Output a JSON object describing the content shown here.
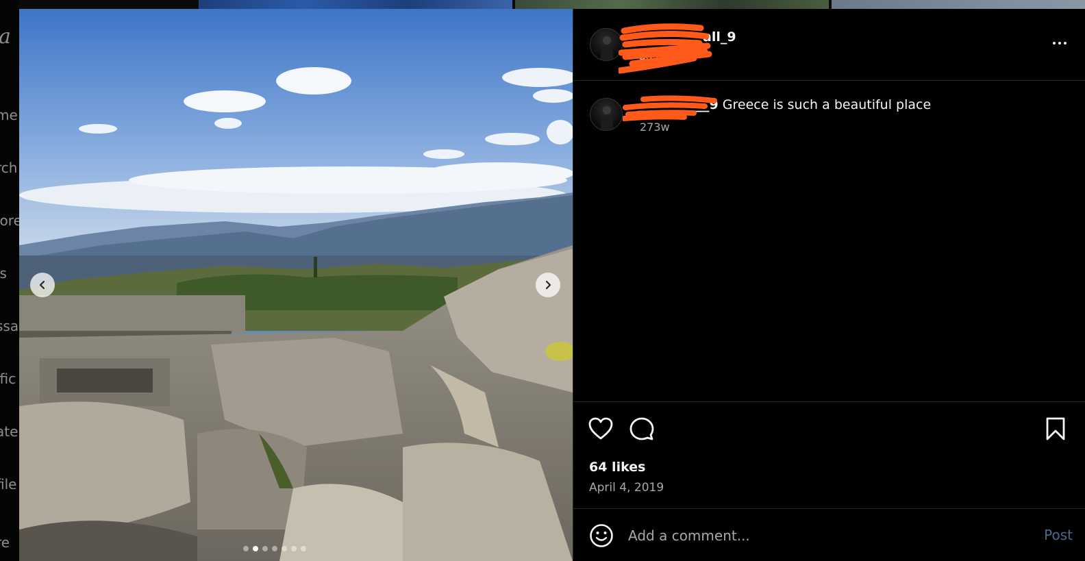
{
  "left_nav": {
    "logo_fragment": "a",
    "items": [
      "me",
      "rch",
      "lore",
      "ls",
      "ssa",
      "ific",
      "ate",
      "file",
      "re"
    ]
  },
  "post": {
    "username": "__________all_9",
    "location": "Greece",
    "caption_user": "___________9",
    "caption": " Greece is such a beautiful place",
    "caption_time": "273w",
    "likes": "64 likes",
    "date": "April 4, 2019",
    "carousel": {
      "total": 7,
      "active_index": 1
    }
  },
  "comment": {
    "placeholder": "Add a comment...",
    "post_label": "Post"
  },
  "icons": {
    "more": "more-horizontal-icon",
    "like": "heart-icon",
    "comment": "comment-bubble-icon",
    "save": "bookmark-icon",
    "emoji": "emoji-smile-icon",
    "prev": "chevron-left-icon",
    "next": "chevron-right-icon"
  },
  "colors": {
    "background": "#000000",
    "text": "#f5f5f5",
    "muted": "#a8a8a8",
    "divider": "#262626",
    "post_button": "#4b6a8a",
    "redaction": "#ff5a1a"
  }
}
